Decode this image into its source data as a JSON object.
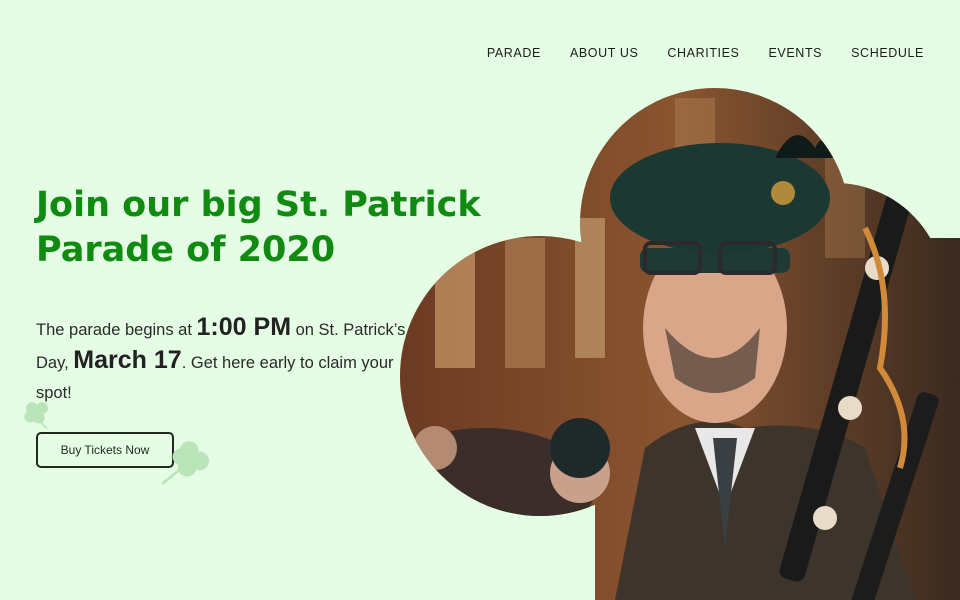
{
  "nav": {
    "items": [
      {
        "label": "PARADE"
      },
      {
        "label": "ABOUT US"
      },
      {
        "label": "CHARITIES"
      },
      {
        "label": "EVENTS"
      },
      {
        "label": "SCHEDULE"
      }
    ]
  },
  "hero": {
    "title": "Join our big St. Patrick Parade of 2020",
    "text_pre_time": "The parade begins at ",
    "time": "1:00 PM",
    "text_mid": " on St. Patrick’s Day, ",
    "date": "March 17",
    "text_post": ". Get here early to claim your spot!",
    "cta_label": "Buy Tickets Now"
  },
  "decor": {
    "clover_small_icon": "shamrock-icon",
    "clover_large_icon": "shamrock-icon",
    "photo_subject": "bagpiper-in-shamrock-frame"
  },
  "colors": {
    "background": "#e4fde4",
    "title": "#108a10",
    "clover": "#b9e5b9"
  }
}
